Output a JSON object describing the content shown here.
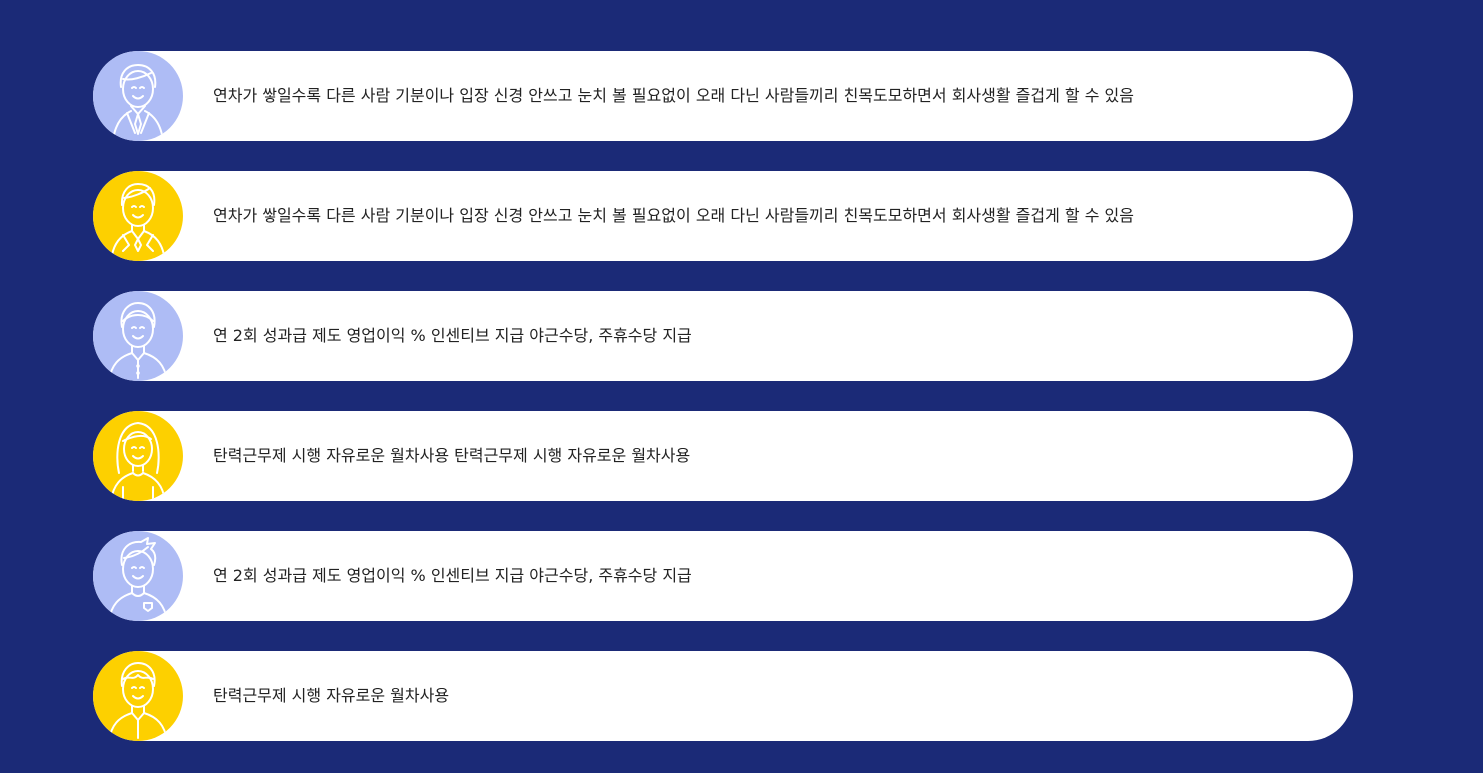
{
  "colors": {
    "background": "#1b2a77",
    "card": "#ffffff",
    "avatar_blue": "#aebcf5",
    "avatar_yellow": "#fdd000",
    "text": "#222222"
  },
  "items": [
    {
      "avatar_icon": "businessman-icon",
      "avatar_color": "blue",
      "text": "연차가 쌓일수록 다른 사람 기분이나 입장 신경 안쓰고 눈치 볼 필요없이 오래 다닌 사람들끼리 친목도모하면서 회사생활 즐겁게 할 수 있음"
    },
    {
      "avatar_icon": "man-in-suit-icon",
      "avatar_color": "yellow",
      "text": "연차가 쌓일수록 다른 사람 기분이나 입장 신경 안쓰고 눈치 볼 필요없이 오래 다닌 사람들끼리 친목도모하면서 회사생활 즐겁게 할 수 있음"
    },
    {
      "avatar_icon": "man-in-shirt-icon",
      "avatar_color": "blue",
      "text": "연 2회 성과급 제도 영업이익 % 인센티브 지급 야근수당, 주휴수당 지급"
    },
    {
      "avatar_icon": "woman-icon",
      "avatar_color": "yellow",
      "text": "탄력근무제 시행 자유로운 월차사용 탄력근무제 시행 자유로운 월차사용"
    },
    {
      "avatar_icon": "young-man-icon",
      "avatar_color": "blue",
      "text": "연 2회 성과급 제도 영업이익 % 인센티브 지급 야근수당, 주휴수당 지급"
    },
    {
      "avatar_icon": "man-icon",
      "avatar_color": "yellow",
      "text": "탄력근무제 시행 자유로운 월차사용"
    }
  ]
}
